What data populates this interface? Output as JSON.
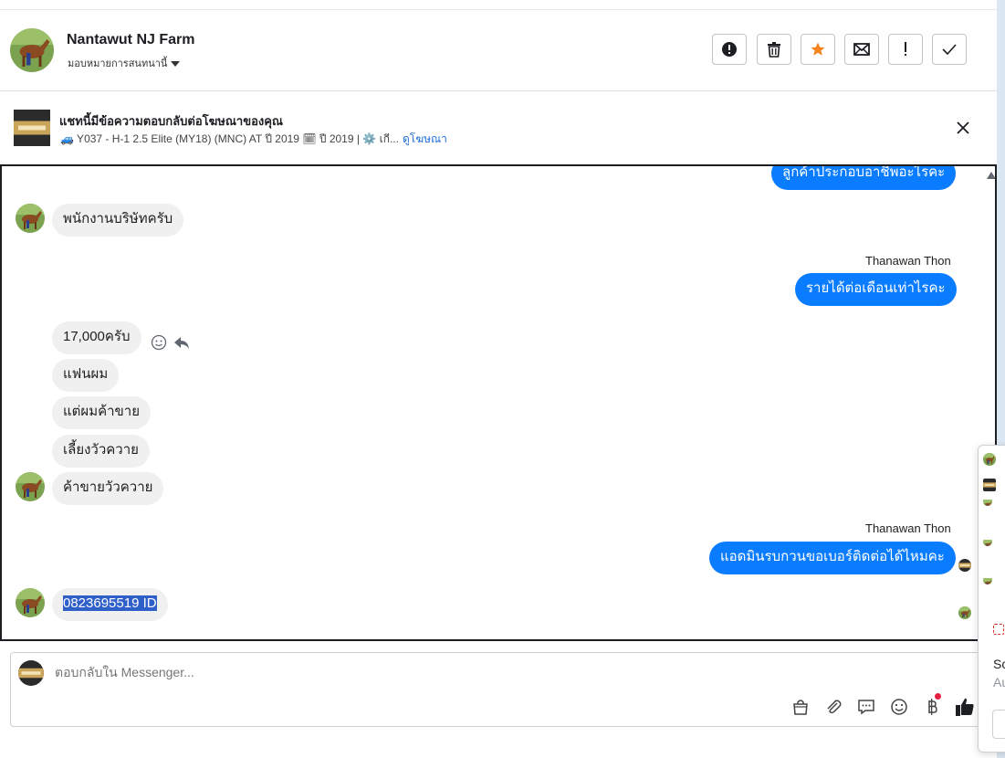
{
  "header": {
    "name": "Nantawut NJ Farm",
    "assign_label": "มอบหมายการสนทนานี้",
    "toolbar": [
      "report-icon",
      "trash-icon",
      "star-icon",
      "mail-icon",
      "important-icon",
      "check-icon"
    ]
  },
  "ad_notice": {
    "title": "แชทนี้มีข้อความตอบกลับต่อโฆษณาของคุณ",
    "description": "🚙 Y037 - H-1 2.5 Elite (MY18) (MNC) AT ปี 2019 🗓 ปี 2019 | ⚙️ เกี...",
    "link": "ดูโฆษณา"
  },
  "messages": {
    "m0": "ลูกค้าประกอบอาชีพอะไรคะ",
    "m1": "พนักงานบริษัทครับ",
    "sender1": "Thanawan Thon",
    "m2": "รายได้ต่อเดือนเท่าไรคะ",
    "m3": "17,000ครับ",
    "m4": "แฟนผม",
    "m5": "แต่ผมค้าขาย",
    "m6": "เลี้ยงวัวควาย",
    "m7": "ค้าขายวัวควาย",
    "sender2": "Thanawan Thon",
    "m8": "แอดมินรบกวนขอเบอร์ติดต่อได้ไหมคะ",
    "m9": "0823695519 ID"
  },
  "composer": {
    "placeholder": "ตอบกลับใน Messenger..."
  },
  "popup": {
    "text1": "Sc",
    "text2": "Au"
  },
  "colors": {
    "outgoing_bubble": "#0a7cff",
    "incoming_bubble": "#f0f0f0",
    "star": "#f5811f"
  }
}
